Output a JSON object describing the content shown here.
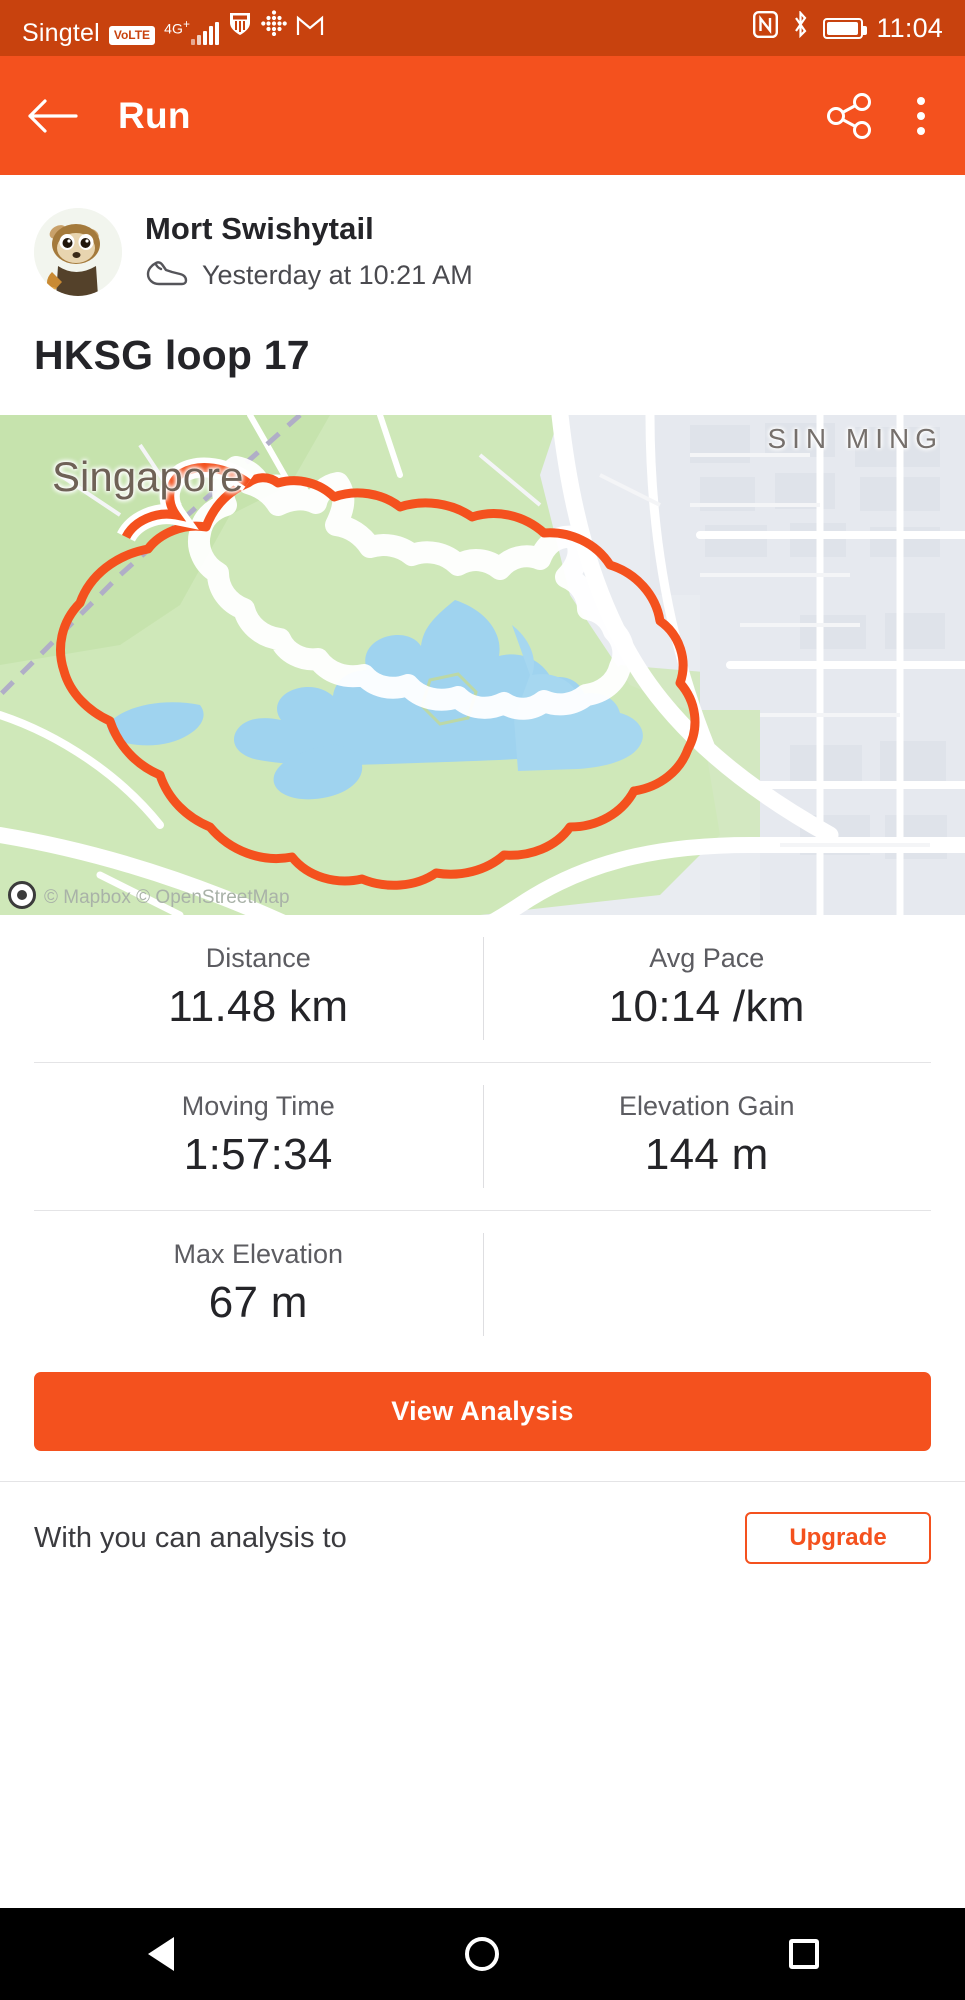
{
  "status_bar": {
    "carrier": "Singtel",
    "volte_badge": "VoLTE",
    "network": "4G",
    "network_plus": "+",
    "clock": "11:04",
    "icons": [
      "signal-bars-icon",
      "vpn-icon",
      "app-grid-icon",
      "gmail-icon",
      "nfc-icon",
      "bluetooth-icon",
      "battery-icon"
    ],
    "background": "#c8420e"
  },
  "app_bar": {
    "title": "Run",
    "back_icon": "back-arrow-icon",
    "share_icon": "share-icon",
    "menu_icon": "overflow-menu-icon",
    "background": "#f4511e"
  },
  "athlete": {
    "name": "Mort Swishytail",
    "activity_icon": "running-shoe-icon",
    "timestamp": "Yesterday at 10:21 AM",
    "avatar_icon": "avatar"
  },
  "activity": {
    "title": "HKSG loop 17"
  },
  "map": {
    "labels": [
      {
        "text": "Singapore",
        "name": "map-label-singapore"
      },
      {
        "text": "SIN MING",
        "name": "map-label-sin-ming"
      }
    ],
    "attribution": "© Mapbox © OpenStreetMap",
    "route_color": "#f4511e",
    "water_color": "#9fd3ef",
    "park_color": "#cfe8b9",
    "logo_icon": "mapbox-logo-icon"
  },
  "stats": {
    "rows": [
      [
        {
          "label": "Distance",
          "value": "11.48 km"
        },
        {
          "label": "Avg Pace",
          "value": "10:14 /km"
        }
      ],
      [
        {
          "label": "Moving Time",
          "value": "1:57:34"
        },
        {
          "label": "Elevation Gain",
          "value": "144 m"
        }
      ],
      [
        {
          "label": "Max Elevation",
          "value": "67 m"
        },
        {
          "label": "",
          "value": ""
        }
      ]
    ]
  },
  "actions": {
    "view_analysis": "View Analysis"
  },
  "peek_section": {
    "text": "With you can analysis to",
    "button": "Upgrade"
  },
  "nav_bar": {
    "back_icon": "nav-back-triangle-icon",
    "home_icon": "nav-home-circle-icon",
    "recents_icon": "nav-recents-square-icon"
  }
}
